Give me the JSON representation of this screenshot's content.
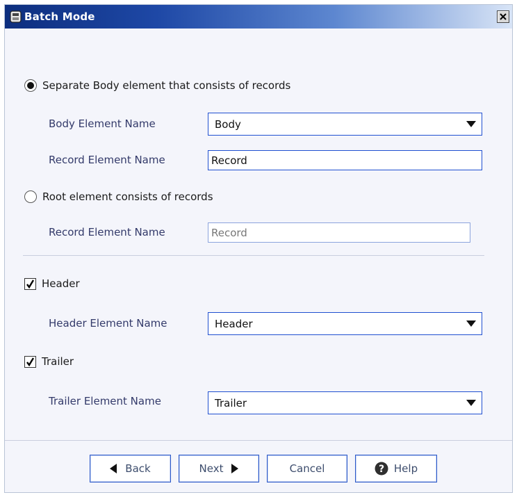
{
  "window": {
    "title": "Batch Mode",
    "title_icon": "wrench-icon",
    "close_icon": "close-icon"
  },
  "option_body": {
    "label": "Separate Body element that consists of records",
    "selected": true,
    "body_label": "Body Element Name",
    "body_value": "Body",
    "record_label": "Record Element Name",
    "record_value": "Record"
  },
  "option_root": {
    "label": "Root element consists of records",
    "selected": false,
    "record_label": "Record Element Name",
    "record_value": "Record"
  },
  "header": {
    "label": "Header",
    "checked": true,
    "name_label": "Header Element Name",
    "name_value": "Header"
  },
  "trailer": {
    "label": "Trailer",
    "checked": true,
    "name_label": "Trailer Element Name",
    "name_value": "Trailer"
  },
  "buttons": {
    "back": "Back",
    "next": "Next",
    "cancel": "Cancel",
    "help": "Help"
  },
  "colors": {
    "accent": "#1f4fd0",
    "title_start": "#0d2e7e",
    "title_end": "#d8e4f6"
  }
}
